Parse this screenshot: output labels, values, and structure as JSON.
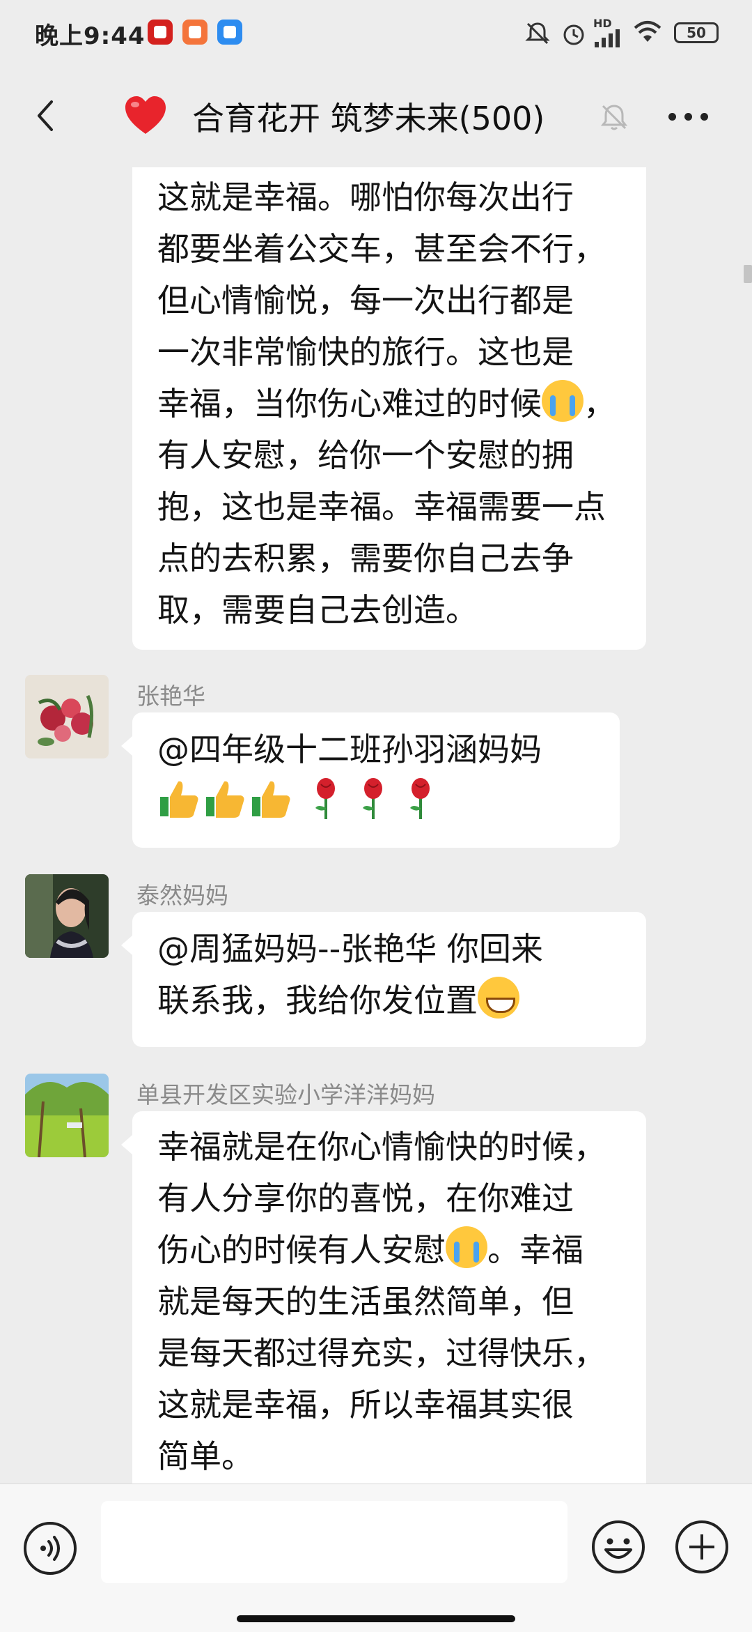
{
  "status_bar": {
    "time": "晚上9:44",
    "network": "HD",
    "battery": "50",
    "icons": [
      "mute-icon",
      "alarm-icon",
      "signal-icon",
      "wifi-icon",
      "battery-icon"
    ]
  },
  "header": {
    "title": "合育花开 筑梦未来(500)",
    "icons": [
      "back-icon",
      "heart-icon",
      "mute-bell-icon",
      "more-icon"
    ]
  },
  "messages": [
    {
      "sender": "",
      "lines": [
        "这就是幸福。哪怕你每次出行",
        "都要坐着公交车，甚至会不行，",
        "但心情愉悦，每一次出行都是",
        "一次非常愉快的旅行。这也是",
        "幸福，当你伤心难过的时候",
        "有人安慰，给你一个安慰的拥",
        "抱，这也是幸福。幸福需要一点",
        "点的去积累，需要你自己去争",
        "取，需要自己去创造。"
      ],
      "line5_suffix": "，"
    },
    {
      "sender": "张艳华",
      "lines": [
        "@四年级十二班孙羽涵妈妈"
      ],
      "emoji_row": [
        "thumbs-up",
        "thumbs-up",
        "thumbs-up",
        "rose",
        "rose",
        "rose"
      ]
    },
    {
      "sender": "泰然妈妈",
      "lines": [
        "@周猛妈妈--张艳华  你回来",
        "联系我，我给你发位置"
      ]
    },
    {
      "sender": "单县开发区实验小学洋洋妈妈",
      "lines": [
        "幸福就是在你心情愉快的时候，",
        "有人分享你的喜悦，在你难过",
        "伤心的时候有人安慰",
        "就是每天的生活虽然简单，但",
        "是每天都过得充实，过得快乐，",
        "这就是幸福，所以幸福其实很",
        "简单。"
      ],
      "line3_suffix": "。幸福"
    }
  ],
  "input_bar": {
    "placeholder": "",
    "icons": [
      "voice-icon",
      "emoji-icon",
      "plus-icon"
    ]
  },
  "colors": {
    "background": "#EDEDED",
    "bubble": "#FFFFFF",
    "sender": "#8A8A8A",
    "heart": "#E8242C"
  }
}
